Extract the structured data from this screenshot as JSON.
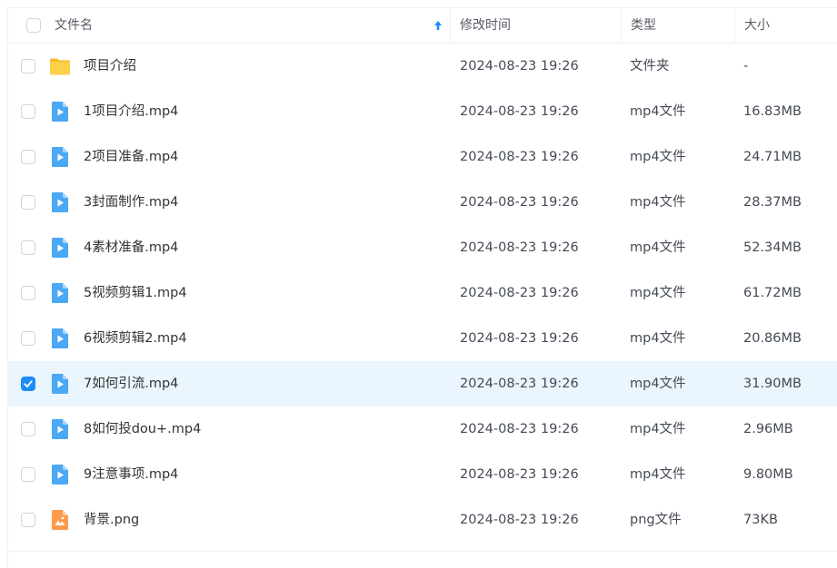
{
  "header": {
    "name_label": "文件名",
    "modified_label": "修改时间",
    "type_label": "类型",
    "size_label": "大小",
    "sort_icon": "arrow-up-icon"
  },
  "files": [
    {
      "name": "项目介绍",
      "modified": "2024-08-23 19:26",
      "type": "文件夹",
      "size": "-",
      "icon": "folder-icon",
      "selected": false
    },
    {
      "name": "1项目介绍.mp4",
      "modified": "2024-08-23 19:26",
      "type": "mp4文件",
      "size": "16.83MB",
      "icon": "video-file-icon",
      "selected": false
    },
    {
      "name": "2项目准备.mp4",
      "modified": "2024-08-23 19:26",
      "type": "mp4文件",
      "size": "24.71MB",
      "icon": "video-file-icon",
      "selected": false
    },
    {
      "name": "3封面制作.mp4",
      "modified": "2024-08-23 19:26",
      "type": "mp4文件",
      "size": "28.37MB",
      "icon": "video-file-icon",
      "selected": false
    },
    {
      "name": "4素材准备.mp4",
      "modified": "2024-08-23 19:26",
      "type": "mp4文件",
      "size": "52.34MB",
      "icon": "video-file-icon",
      "selected": false
    },
    {
      "name": "5视频剪辑1.mp4",
      "modified": "2024-08-23 19:26",
      "type": "mp4文件",
      "size": "61.72MB",
      "icon": "video-file-icon",
      "selected": false
    },
    {
      "name": "6视频剪辑2.mp4",
      "modified": "2024-08-23 19:26",
      "type": "mp4文件",
      "size": "20.86MB",
      "icon": "video-file-icon",
      "selected": false
    },
    {
      "name": "7如何引流.mp4",
      "modified": "2024-08-23 19:26",
      "type": "mp4文件",
      "size": "31.90MB",
      "icon": "video-file-icon",
      "selected": true
    },
    {
      "name": "8如何投dou+.mp4",
      "modified": "2024-08-23 19:26",
      "type": "mp4文件",
      "size": "2.96MB",
      "icon": "video-file-icon",
      "selected": false
    },
    {
      "name": "9注意事项.mp4",
      "modified": "2024-08-23 19:26",
      "type": "mp4文件",
      "size": "9.80MB",
      "icon": "video-file-icon",
      "selected": false
    },
    {
      "name": "背景.png",
      "modified": "2024-08-23 19:26",
      "type": "png文件",
      "size": "73KB",
      "icon": "image-file-icon",
      "selected": false
    }
  ],
  "colors": {
    "accent": "#1d8cf8",
    "selected_row": "#eaf5fd",
    "folder": "#fbc02d",
    "video_icon": "#4aa8f5",
    "image_icon": "#ff9a4a"
  }
}
